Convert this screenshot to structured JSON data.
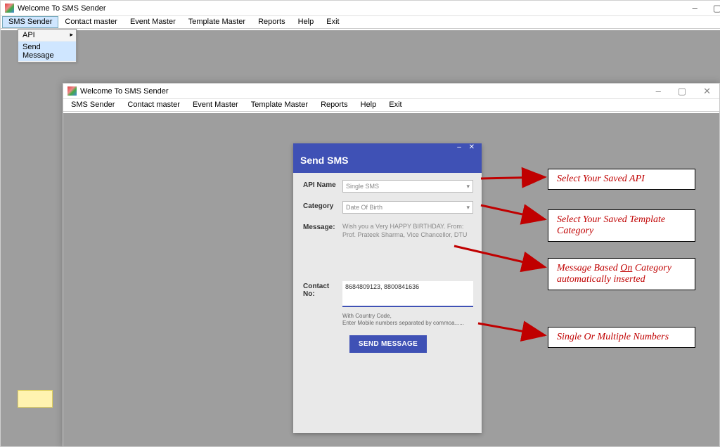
{
  "winA": {
    "title": "Welcome To SMS Sender",
    "controls": {
      "min": "–",
      "max": "▢",
      "close": "✕"
    },
    "menu": [
      "SMS Sender",
      "Contact master",
      "Event Master",
      "Template Master",
      "Reports",
      "Help",
      "Exit"
    ],
    "dropdown": {
      "item0": "API",
      "item1": "Send Message"
    }
  },
  "winB": {
    "title": "Welcome To SMS Sender",
    "controls": {
      "min": "–",
      "max": "▢",
      "close": "✕"
    },
    "menu": [
      "SMS Sender",
      "Contact master",
      "Event Master",
      "Template Master",
      "Reports",
      "Help",
      "Exit"
    ]
  },
  "dialog": {
    "controls": "– ✕",
    "title": "Send SMS",
    "labels": {
      "api": "API Name",
      "category": "Category",
      "message": "Message:",
      "contact": "Contact No:"
    },
    "api_value": "Single SMS",
    "category_value": "Date Of Birth",
    "message_text": "Wish you a Very HAPPY BIRTHDAY. From: Prof. Prateek Sharma, Vice Chancellor, DTU",
    "contact_value": "8684809123, 8800841636",
    "helper1": "With Country Code,",
    "helper2": "Enter Mobile numbers separated by commoa......",
    "send_btn": "SEND MESSAGE"
  },
  "callouts": {
    "c1": "Select Your Saved API",
    "c2": "Select Your Saved Template Category",
    "c3_pre": "Message Based ",
    "c3_u": "On",
    "c3_post": " Category automatically  inserted",
    "c4": "Single Or Multiple Numbers"
  }
}
